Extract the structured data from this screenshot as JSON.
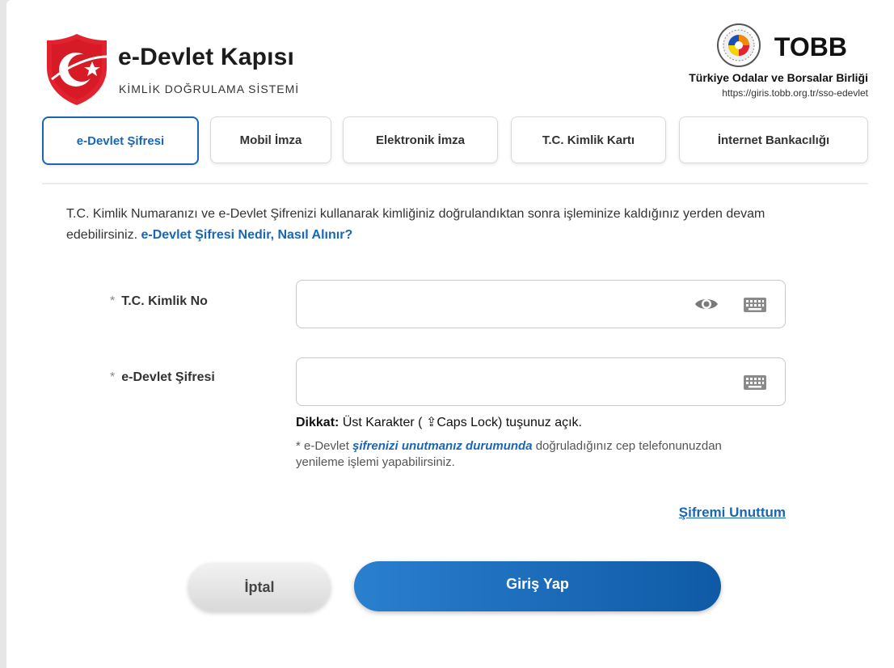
{
  "header": {
    "title": "e-Devlet Kapısı",
    "subtitle": "KİMLİK DOĞRULAMA SİSTEMİ",
    "logo_icon": "turkish-crescent-shield-icon",
    "org_short": "TOBB",
    "org_full": "Türkiye Odalar ve Borsalar Birliği",
    "org_url": "https://giris.tobb.org.tr/sso-edevlet",
    "org_logo_icon": "tobb-seal-icon"
  },
  "tabs": [
    {
      "label": "e-Devlet Şifresi",
      "active": true
    },
    {
      "label": "Mobil İmza",
      "active": false
    },
    {
      "label": "Elektronik İmza",
      "active": false
    },
    {
      "label": "T.C. Kimlik Kartı",
      "active": false
    },
    {
      "label": "İnternet Bankacılığı",
      "active": false
    }
  ],
  "intro": {
    "text": "T.C. Kimlik Numaranızı ve e-Devlet Şifrenizi kullanarak kimliğiniz doğrulandıktan sonra işleminize kaldığınız yerden devam edebilirsiniz.",
    "link": "e-Devlet Şifresi Nedir, Nasıl Alınır?"
  },
  "form": {
    "tc_label": "T.C. Kimlik No",
    "tc_value": "",
    "password_label": "e-Devlet Şifresi",
    "password_value": "",
    "required_mark": "*"
  },
  "warning": {
    "bold": "Dikkat:",
    "text": "Üst Karakter ( ⇪Caps Lock) tuşunuz açık."
  },
  "note": {
    "prefix": "* e-Devlet ",
    "emphasis": "şifrenizi unutmanız durumunda",
    "suffix": " doğruladığınız cep telefonunuzdan yenileme işlemi yapabilirsiniz."
  },
  "forgot_link": "Şifremi Unuttum",
  "buttons": {
    "cancel": "İptal",
    "login": "Giriş Yap"
  },
  "colors": {
    "accent": "#1a66b3",
    "brand_red": "#e3222f"
  }
}
